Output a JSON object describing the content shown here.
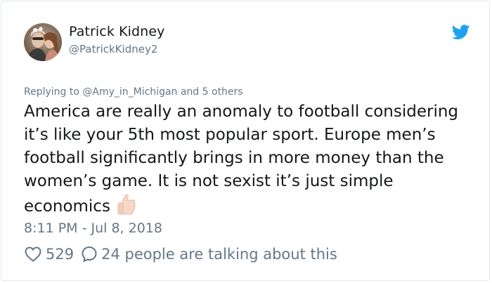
{
  "tweet": {
    "author": {
      "display_name": "Patrick Kidney",
      "handle": "@PatrickKidney2"
    },
    "platform_icon": "twitter-bird-icon",
    "reply_context": "Replying to @Amy_in_Michigan and 5 others",
    "text": "America are really an anomaly to football considering it’s like your 5th most popular sport. Europe men’s football significantly brings in more money than the women’s game. It is not sexist it’s just simple economics",
    "emoji": "thumbs-up-icon",
    "timestamp": "8:11 PM - Jul 8, 2018",
    "likes": "529",
    "talking": "24 people are talking about this"
  },
  "colors": {
    "brand_blue": "#1da1f2",
    "text_primary": "#14171a",
    "text_secondary": "#657786",
    "border": "#e1e8ed"
  }
}
